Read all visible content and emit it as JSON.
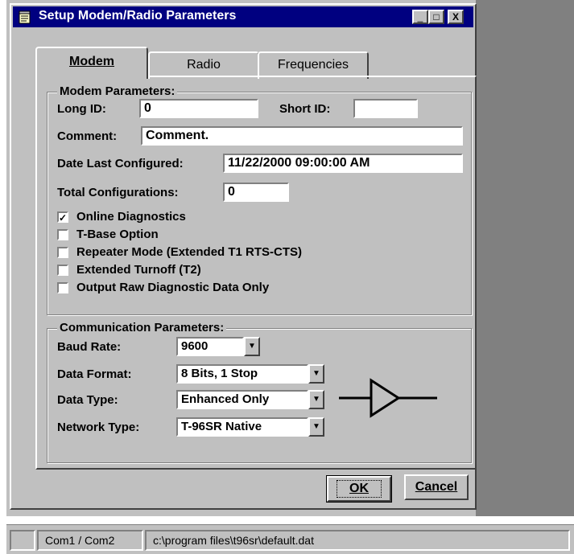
{
  "window": {
    "title": "Setup Modem/Radio Parameters",
    "minimize_glyph": "_",
    "maximize_glyph": "□",
    "close_glyph": "X"
  },
  "tabs": [
    {
      "label": "Modem",
      "active": true
    },
    {
      "label": "Radio",
      "active": false
    },
    {
      "label": "Frequencies",
      "active": false
    }
  ],
  "modem_params": {
    "group_title": "Modem Parameters:",
    "long_id_label": "Long ID:",
    "long_id_value": "0",
    "short_id_label": "Short ID:",
    "short_id_value": "",
    "comment_label": "Comment:",
    "comment_value": "Comment.",
    "date_label": "Date Last Configured:",
    "date_value": "11/22/2000 09:00:00 AM",
    "total_label": "Total Configurations:",
    "total_value": "0",
    "checkboxes": [
      {
        "label": "Online Diagnostics",
        "checked": true
      },
      {
        "label": "T-Base Option",
        "checked": false
      },
      {
        "label": "Repeater Mode (Extended T1 RTS-CTS)",
        "checked": false
      },
      {
        "label": "Extended Turnoff (T2)",
        "checked": false
      },
      {
        "label": "Output Raw Diagnostic Data Only",
        "checked": false
      }
    ]
  },
  "comm_params": {
    "group_title": "Communication Parameters:",
    "baud_label": "Baud Rate:",
    "baud_value": "9600",
    "format_label": "Data Format:",
    "format_value": "8 Bits, 1 Stop",
    "type_label": "Data Type:",
    "type_value": "Enhanced Only",
    "network_label": "Network Type:",
    "network_value": "T-96SR Native",
    "symbol_icon": "amplifier-symbol-icon"
  },
  "buttons": {
    "ok": "OK",
    "cancel": "Cancel"
  },
  "statusbar": {
    "ports": "Com1 / Com2",
    "path": "c:\\program files\\t96sr\\default.dat"
  },
  "colors": {
    "titlebar": "#000080",
    "face": "#c0c0c0",
    "right_panel": "#808080"
  }
}
